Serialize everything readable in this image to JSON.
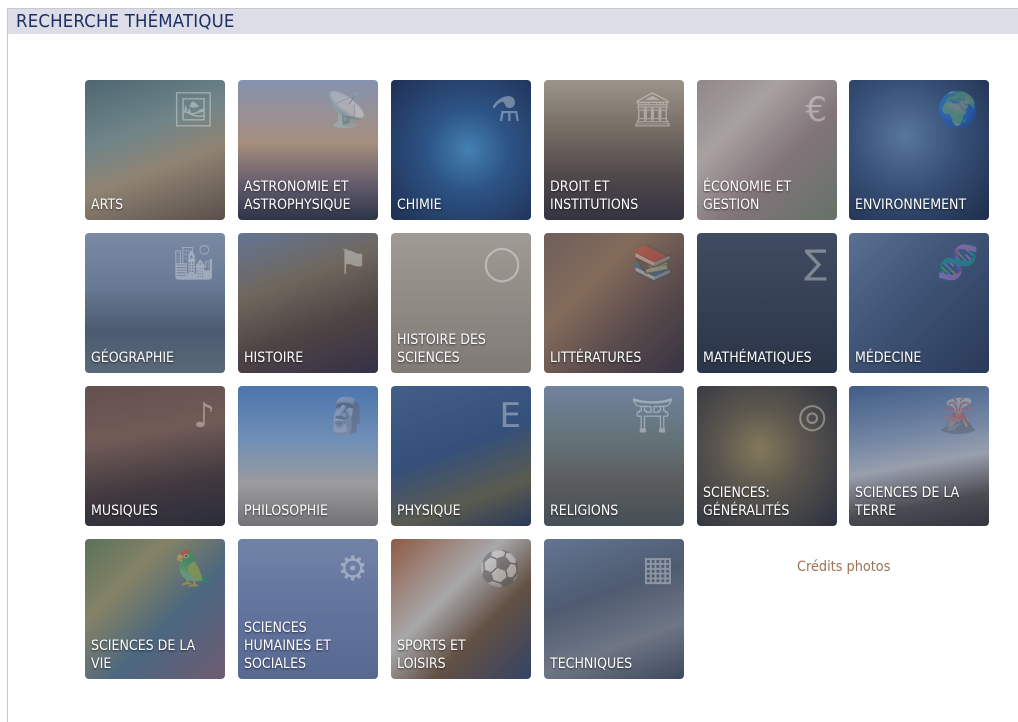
{
  "header": {
    "title": "RECHERCHE THÉMATIQUE"
  },
  "tiles": [
    {
      "label": "ARTS",
      "icon": "palette-icon"
    },
    {
      "label": "ASTRONOMIE ET\nASTROPHYSIQUE",
      "icon": "satellite-dish-icon"
    },
    {
      "label": "CHIMIE",
      "icon": "molecule-icon"
    },
    {
      "label": "DROIT ET\nINSTITUTIONS",
      "icon": "parliament-icon"
    },
    {
      "label": "ÉCONOMIE ET\nGESTION",
      "icon": "banknote-icon"
    },
    {
      "label": "ENVIRONNEMENT",
      "icon": "earth-icon"
    },
    {
      "label": "GÉOGRAPHIE",
      "icon": "city-icon"
    },
    {
      "label": "HISTOIRE",
      "icon": "flag-icon"
    },
    {
      "label": "HISTOIRE DES\nSCIENCES",
      "icon": "vitruvian-icon"
    },
    {
      "label": "LITTÉRATURES",
      "icon": "books-icon"
    },
    {
      "label": "MATHÉMATIQUES",
      "icon": "formula-icon"
    },
    {
      "label": "MÉDECINE",
      "icon": "dna-icon"
    },
    {
      "label": "MUSIQUES",
      "icon": "cello-icon"
    },
    {
      "label": "PHILOSOPHIE",
      "icon": "statue-icon"
    },
    {
      "label": "PHYSIQUE",
      "icon": "emc2-icon"
    },
    {
      "label": "RELIGIONS",
      "icon": "temple-icon"
    },
    {
      "label": "SCIENCES:\nGÉNÉRALITÉS",
      "icon": "golden-record-icon"
    },
    {
      "label": "SCIENCES DE LA\nTERRE",
      "icon": "volcano-icon"
    },
    {
      "label": "SCIENCES DE LA VIE",
      "icon": "animals-icon"
    },
    {
      "label": "SCIENCES\nHUMAINES ET\nSOCIALES",
      "icon": "gears-head-icon"
    },
    {
      "label": "SPORTS ET LOISIRS",
      "icon": "ball-icon"
    },
    {
      "label": "TECHNIQUES",
      "icon": "circuit-board-icon"
    }
  ],
  "credits": {
    "label": "Crédits photos"
  },
  "colors": {
    "header_bg": "#dcdde6",
    "header_text": "#1c2f66",
    "credits_text": "#9b7255",
    "tile_text": "#ffffff"
  }
}
